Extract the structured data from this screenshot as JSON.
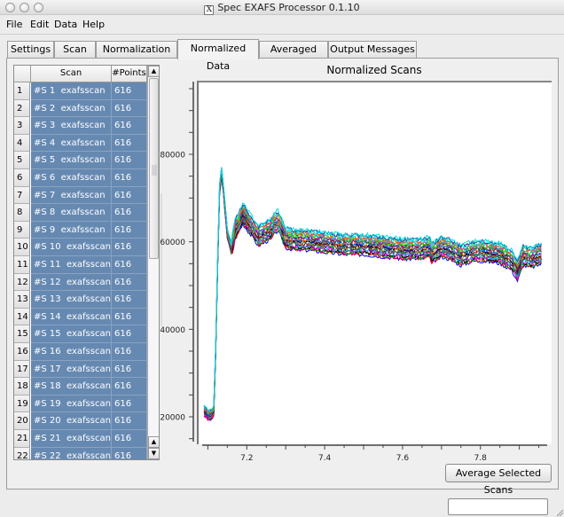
{
  "window": {
    "title": "Spec EXAFS Processor 0.1.10",
    "x_logo": "X"
  },
  "menu": [
    "File",
    "Edit",
    "Data",
    "Help"
  ],
  "tabs": [
    {
      "label": "Settings",
      "active": false
    },
    {
      "label": "Scan Info",
      "active": false
    },
    {
      "label": "Normalization",
      "active": false
    },
    {
      "label": "Normalized Data",
      "active": true
    },
    {
      "label": "Averaged Data",
      "active": false
    },
    {
      "label": "Output Messages",
      "active": false
    }
  ],
  "table": {
    "headers": [
      "",
      "Scan",
      "#Points"
    ],
    "rows": [
      {
        "num": "1",
        "scan": "#S 1  exafsscan",
        "points": "616"
      },
      {
        "num": "2",
        "scan": "#S 2  exafsscan",
        "points": "616"
      },
      {
        "num": "3",
        "scan": "#S 3  exafsscan",
        "points": "616"
      },
      {
        "num": "4",
        "scan": "#S 4  exafsscan",
        "points": "616"
      },
      {
        "num": "5",
        "scan": "#S 5  exafsscan",
        "points": "616"
      },
      {
        "num": "6",
        "scan": "#S 6  exafsscan",
        "points": "616"
      },
      {
        "num": "7",
        "scan": "#S 7  exafsscan",
        "points": "616"
      },
      {
        "num": "8",
        "scan": "#S 8  exafsscan",
        "points": "616"
      },
      {
        "num": "9",
        "scan": "#S 9  exafsscan",
        "points": "616"
      },
      {
        "num": "10",
        "scan": "#S 10  exafsscan",
        "points": "616"
      },
      {
        "num": "11",
        "scan": "#S 11  exafsscan",
        "points": "616"
      },
      {
        "num": "12",
        "scan": "#S 12  exafsscan",
        "points": "616"
      },
      {
        "num": "13",
        "scan": "#S 13  exafsscan",
        "points": "616"
      },
      {
        "num": "14",
        "scan": "#S 14  exafsscan",
        "points": "616"
      },
      {
        "num": "15",
        "scan": "#S 15  exafsscan",
        "points": "616"
      },
      {
        "num": "16",
        "scan": "#S 16  exafsscan",
        "points": "616"
      },
      {
        "num": "17",
        "scan": "#S 17  exafsscan",
        "points": "616"
      },
      {
        "num": "18",
        "scan": "#S 18  exafsscan",
        "points": "616"
      },
      {
        "num": "19",
        "scan": "#S 19  exafsscan",
        "points": "616"
      },
      {
        "num": "20",
        "scan": "#S 20  exafsscan",
        "points": "616"
      },
      {
        "num": "21",
        "scan": "#S 21  exafsscan",
        "points": "616"
      },
      {
        "num": "22",
        "scan": "#S 22  exafsscan",
        "points": "616"
      }
    ],
    "selection_color": "#6689b2"
  },
  "buttons": {
    "average": "Average Selected Scans"
  },
  "status_field": {
    "value": ""
  },
  "chart_data": {
    "type": "line",
    "title": "Normalized Scans",
    "xlabel": "",
    "ylabel": "",
    "xlim": [
      7.09,
      7.96
    ],
    "ylim": [
      11000,
      93000
    ],
    "x_ticks": [
      "7.2",
      "7.4",
      "7.6",
      "7.8"
    ],
    "x_tick_values": [
      7.2,
      7.4,
      7.6,
      7.8
    ],
    "y_ticks": [
      "20000",
      "40000",
      "60000",
      "80000"
    ],
    "y_tick_values": [
      20000,
      40000,
      60000,
      80000
    ],
    "series_count": 22,
    "series_colors": [
      "#0000ff",
      "#ff0000",
      "#00a000",
      "#000000",
      "#ff00ff",
      "#00cccc",
      "#800080",
      "#808000",
      "#008080",
      "#800000",
      "#000080",
      "#ff8000",
      "#0080ff",
      "#404040",
      "#c00060",
      "#00ff00",
      "#6060ff",
      "#a0a000",
      "#ff4040",
      "#00ffff",
      "#2040a0",
      "#00e0e0"
    ],
    "representative_series": {
      "x": [
        7.09,
        7.1,
        7.11,
        7.115,
        7.12,
        7.125,
        7.13,
        7.135,
        7.14,
        7.15,
        7.16,
        7.17,
        7.19,
        7.21,
        7.23,
        7.26,
        7.28,
        7.3,
        7.33,
        7.36,
        7.4,
        7.45,
        7.5,
        7.55,
        7.6,
        7.65,
        7.67,
        7.675,
        7.7,
        7.72,
        7.75,
        7.78,
        7.81,
        7.85,
        7.88,
        7.895,
        7.91,
        7.93,
        7.96
      ],
      "y": [
        21500,
        20500,
        20500,
        21500,
        35000,
        55000,
        72000,
        76000,
        72000,
        62000,
        58500,
        63000,
        66500,
        64000,
        61500,
        63000,
        65000,
        61000,
        60500,
        60500,
        60000,
        59500,
        59500,
        59000,
        58500,
        58500,
        59000,
        57500,
        59000,
        58500,
        57000,
        58000,
        58000,
        57500,
        56000,
        53500,
        57000,
        56500,
        57500
      ]
    }
  }
}
